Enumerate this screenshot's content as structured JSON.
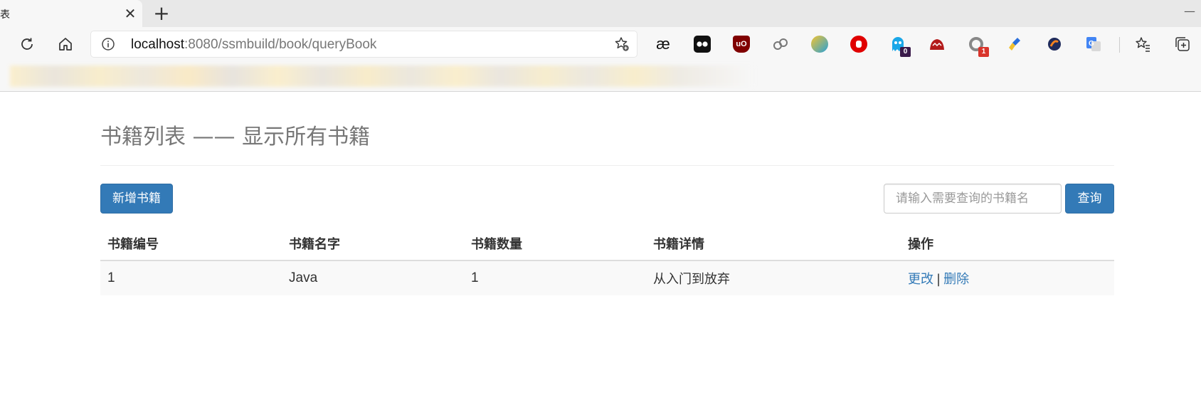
{
  "browser": {
    "tab_title_fragment": "表",
    "url_host": "localhost",
    "url_path": ":8080/ssmbuild/book/queryBook",
    "extensions": [
      {
        "name": "ae-icon",
        "text": "æ"
      },
      {
        "name": "tampermonkey-icon",
        "text": ""
      },
      {
        "name": "ublock-icon",
        "text": "uO"
      },
      {
        "name": "link-icon",
        "text": ""
      },
      {
        "name": "bird-icon",
        "text": ""
      },
      {
        "name": "stop-icon",
        "text": ""
      },
      {
        "name": "ghost-icon",
        "badge": "0"
      },
      {
        "name": "monster-icon",
        "text": ""
      },
      {
        "name": "circle-icon",
        "badge": "1"
      },
      {
        "name": "broom-icon",
        "text": ""
      },
      {
        "name": "swirl-icon",
        "text": ""
      },
      {
        "name": "translate-icon",
        "text": ""
      }
    ],
    "colors": {
      "accent": "#337ab7",
      "tab_bg": "#f7f7f7",
      "chrome_bg": "#e8e8e8"
    }
  },
  "page": {
    "title": "书籍列表 —— 显示所有书籍",
    "add_button": "新增书籍",
    "search_placeholder": "请输入需要查询的书籍名",
    "search_button": "查询",
    "table": {
      "headers": [
        "书籍编号",
        "书籍名字",
        "书籍数量",
        "书籍详情",
        "操作"
      ],
      "rows": [
        {
          "id": "1",
          "name": "Java",
          "count": "1",
          "detail": "从入门到放弃",
          "edit": "更改",
          "sep": "|",
          "delete": "删除"
        }
      ]
    }
  }
}
